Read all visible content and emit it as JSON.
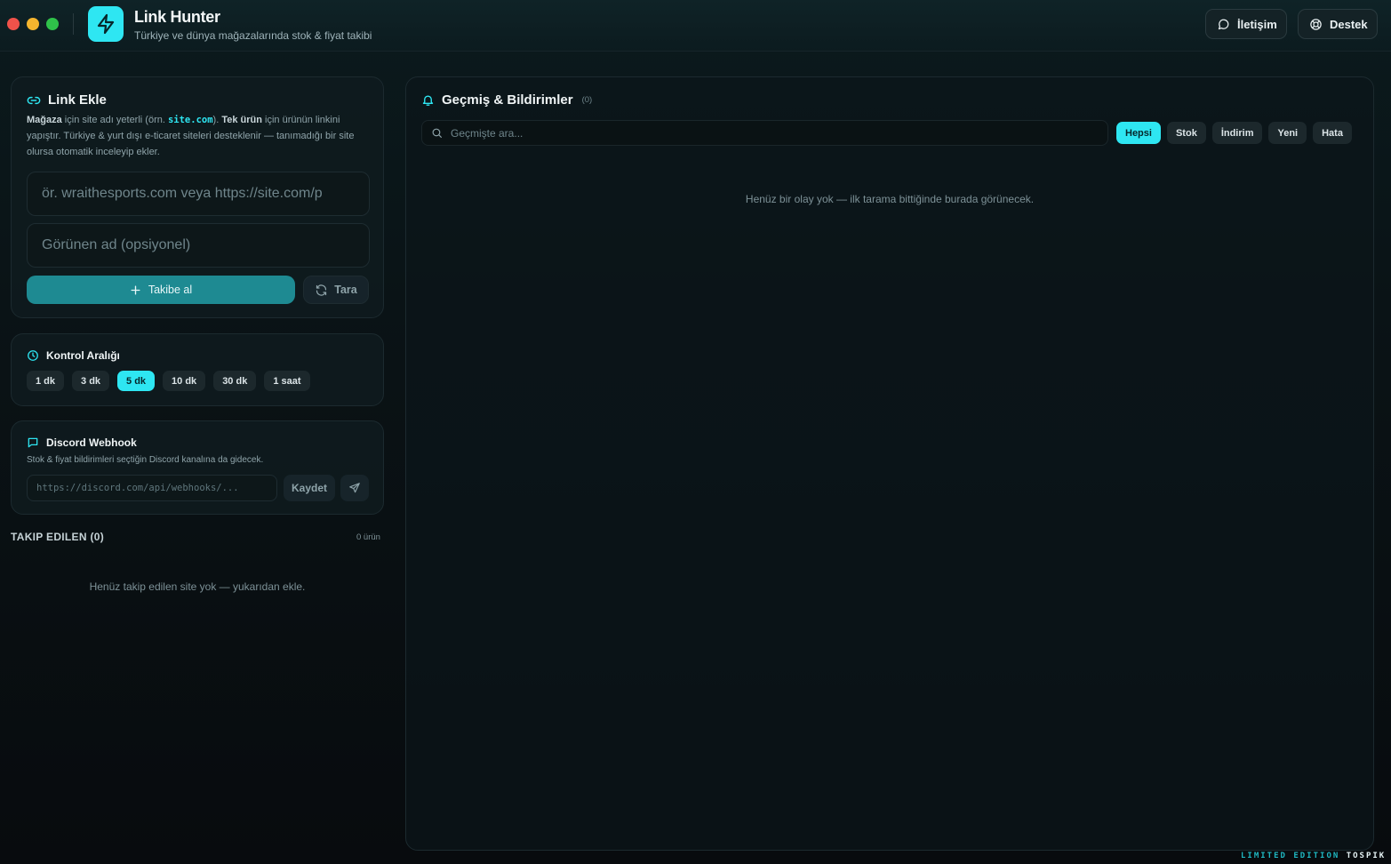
{
  "window": {
    "app_title": "Link Hunter",
    "app_subtitle": "Türkiye ve dünya mağazalarında stok & fiyat takibi"
  },
  "header": {
    "contact_label": "İletişim",
    "support_label": "Destek"
  },
  "add_link": {
    "title": "Link Ekle",
    "desc_store": "Mağaza",
    "desc_part1": " için site adı yeterli (örn. ",
    "desc_example": "site.com",
    "desc_part2": "). ",
    "desc_product": "Tek ürün",
    "desc_part3": " için ürünün linkini yapıştır. Türkiye & yurt dışı e-ticaret siteleri desteklenir — tanımadığı bir site olursa otomatik inceleyip ekler.",
    "url_placeholder": "ör. wraithesports.com  veya  https://site.com/p",
    "name_placeholder": "Görünen ad (opsiyonel)",
    "track_button": "Takibe al",
    "scan_button": "Tara"
  },
  "interval": {
    "title": "Kontrol Aralığı",
    "options": [
      "1 dk",
      "3 dk",
      "5 dk",
      "10 dk",
      "30 dk",
      "1 saat"
    ],
    "selected": "5 dk"
  },
  "webhook": {
    "title": "Discord Webhook",
    "description": "Stok & fiyat bildirimleri seçtiğin Discord kanalına da gidecek.",
    "placeholder": "https://discord.com/api/webhooks/...",
    "save_button": "Kaydet"
  },
  "tracked": {
    "heading": "TAKIP EDILEN (0)",
    "count": "0 ürün",
    "empty": "Henüz takip edilen site yok — yukarıdan ekle."
  },
  "history": {
    "title": "Geçmiş & Bildirimler",
    "count": "(0)",
    "search_placeholder": "Geçmişte ara...",
    "filters": [
      "Hepsi",
      "Stok",
      "İndirim",
      "Yeni",
      "Hata"
    ],
    "selected_filter": "Hepsi",
    "empty": "Henüz bir olay yok — ilk tarama bittiğinde burada görünecek."
  },
  "footer": {
    "edition": "LIMITED EDITION",
    "author": "TOSPIK"
  },
  "colors": {
    "accent": "#2ee6f2",
    "primary_button": "#1e8a92",
    "background": "#0a1316"
  },
  "icons": {
    "logo": "lightning-bolt-icon",
    "contact": "chat-bubble-icon",
    "support": "lifebuoy-icon",
    "link": "link-icon",
    "clock": "clock-icon",
    "discord": "message-square-icon",
    "bell": "bell-icon",
    "search": "search-icon",
    "send": "send-icon"
  }
}
